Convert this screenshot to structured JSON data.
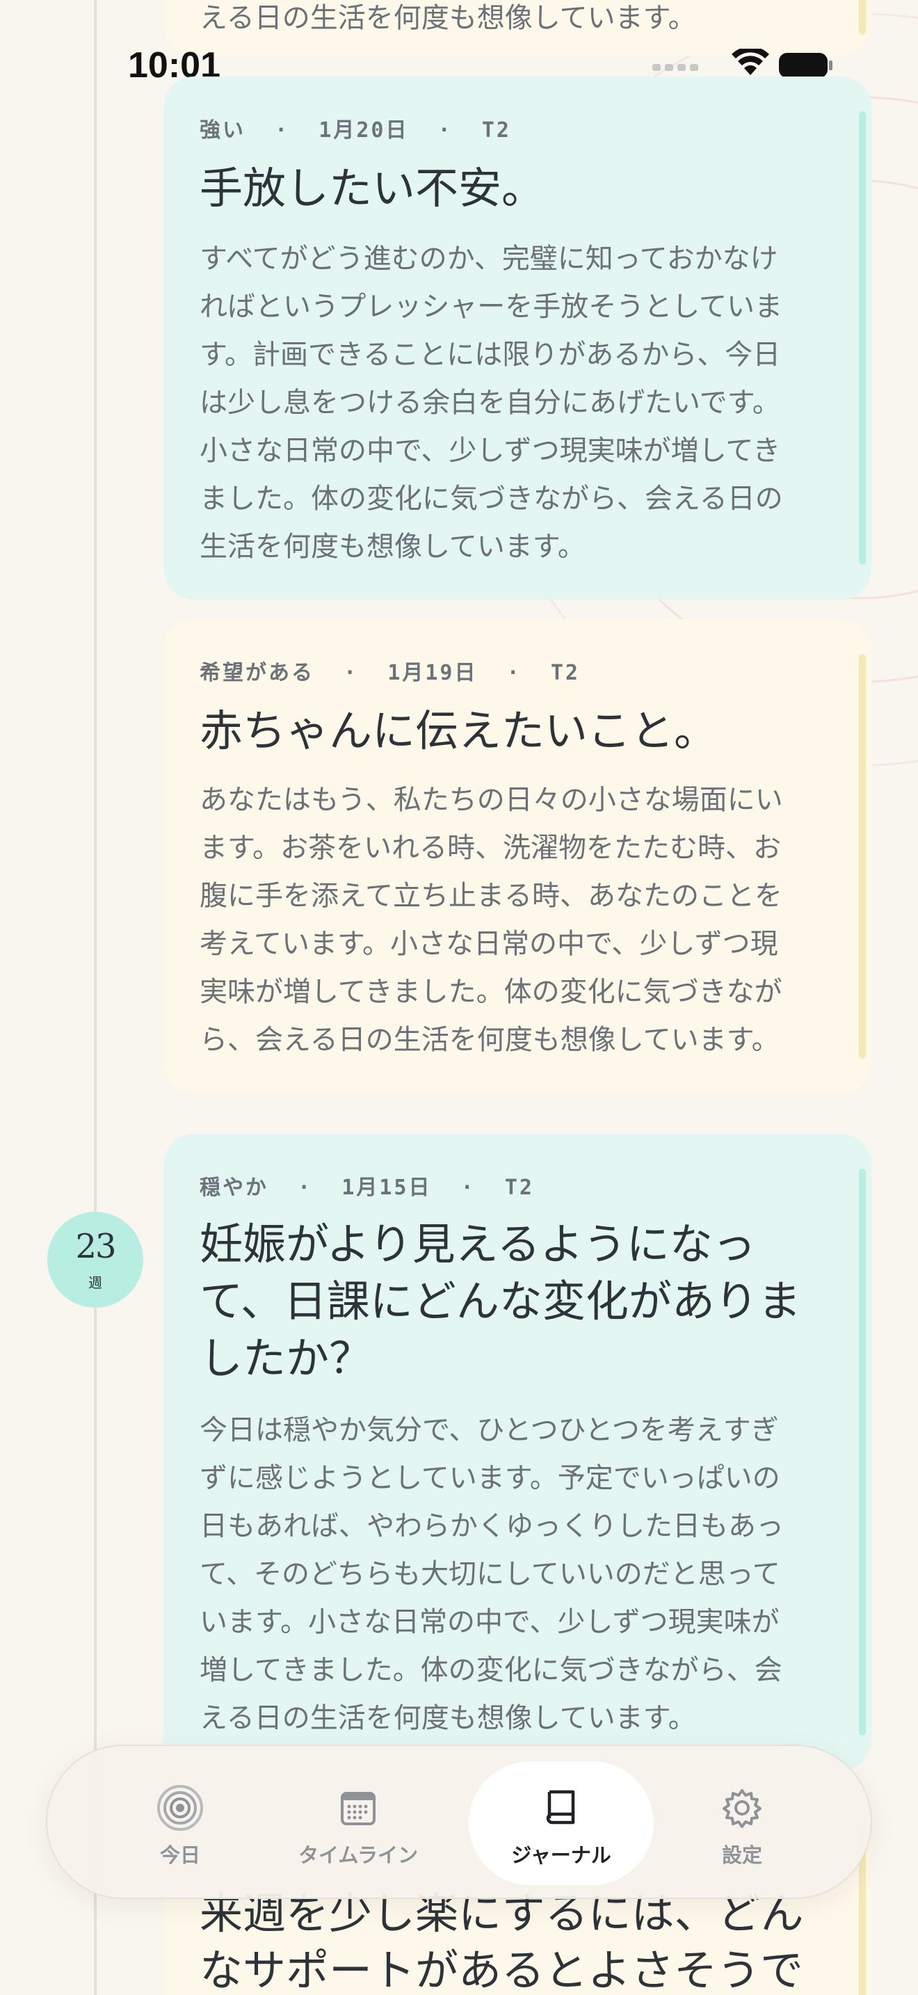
{
  "status_bar": {
    "time": "10:01",
    "icons": [
      "signal-dots-icon",
      "wifi-icon",
      "battery-icon"
    ]
  },
  "entries": [
    {
      "partial_text": "える日の生活を何度も想像しています。"
    },
    {
      "mood": "強い",
      "date": "1月20日",
      "trimester": "T2",
      "title": "手放したい不安。",
      "body": [
        "すべてがどう進むのか、完璧に知っておかなけ",
        "ればというプレッシャーを手放そうとしていま",
        "す。計画できることには限りがあるから、今日",
        "は少し息をつける余白を自分にあげたいです。",
        "小さな日常の中で、少しずつ現実味が増してき",
        "ました。体の変化に気づきながら、会える日の",
        "生活を何度も想像しています。"
      ]
    },
    {
      "mood": "希望がある",
      "date": "1月19日",
      "trimester": "T2",
      "title": "赤ちゃんに伝えたいこと。",
      "body": [
        "あなたはもう、私たちの日々の小さな場面にい",
        "ます。お茶をいれる時、洗濯物をたたむ時、お",
        "腹に手を添えて立ち止まる時、あなたのことを",
        "考えています。小さな日常の中で、少しずつ現",
        "実味が増してきました。体の変化に気づきなが",
        "ら、会える日の生活を何度も想像しています。"
      ]
    },
    {
      "mood": "穏やか",
      "date": "1月15日",
      "trimester": "T2",
      "title": [
        "妊娠がより見えるようになっ",
        "て、日課にどんな変化がありま",
        "したか？"
      ],
      "body": [
        "今日は穏やか気分で、ひとつひとつを考えすぎ",
        "ずに感じようとしています。予定でいっぱいの",
        "日もあれば、やわらかくゆっくりした日もあっ",
        "て、そのどちらも大切にしていいのだと思って",
        "います。小さな日常の中で、少しずつ現実味が",
        "増してきました。体の変化に気づきながら、会",
        "える日の生活を何度も想像しています。"
      ]
    },
    {
      "title_partial": [
        "来週を少し楽にするには、どん",
        "なサポートがあるとよさそうで"
      ]
    }
  ],
  "week_badge": {
    "number": "23",
    "unit": "週"
  },
  "tabs": [
    {
      "label": "今日",
      "icon": "rings-icon",
      "active": false
    },
    {
      "label": "タイムライン",
      "icon": "calendar-icon",
      "active": false
    },
    {
      "label": "ジャーナル",
      "icon": "book-icon",
      "active": true
    },
    {
      "label": "設定",
      "icon": "gear-icon",
      "active": false
    }
  ],
  "colors": {
    "background": "#f9f5ef",
    "mint_card": "#e3f6f1",
    "cream_card": "#fdf8ea",
    "mint_accent": "#b9eee2",
    "cream_accent": "#f6e9b8"
  }
}
